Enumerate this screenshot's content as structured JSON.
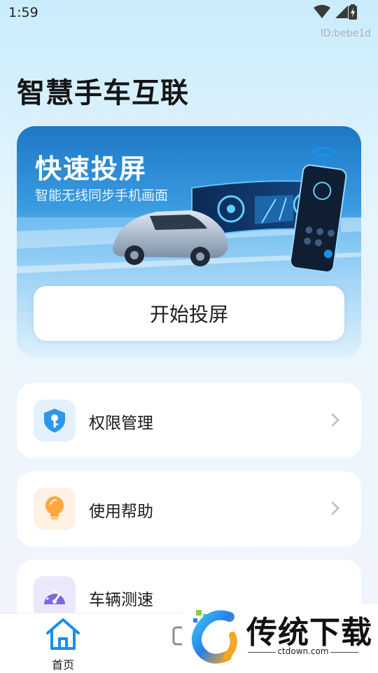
{
  "status_bar": {
    "time": "1:59"
  },
  "device_id": "ID:bebe1d",
  "app_title": "智慧手车互联",
  "hero": {
    "title": "快速投屏",
    "subtitle": "智能无线同步手机画面",
    "button_label": "开始投屏"
  },
  "menu": [
    {
      "label": "权限管理",
      "icon": "shield-key-icon",
      "icon_bg": "#e4f1fd"
    },
    {
      "label": "使用帮助",
      "icon": "lightbulb-icon",
      "icon_bg": "#fff1e3"
    },
    {
      "label": "车辆测速",
      "icon": "speedometer-icon",
      "icon_bg": "#ece8fb"
    }
  ],
  "bottom_nav": {
    "home_label": "首页"
  },
  "watermark": {
    "brand": "传统下载",
    "domain": "ctdown.com"
  },
  "colors": {
    "accent": "#1a8fe8",
    "card_bg": "#ffffff",
    "page_bg_top": "#c9ecfb"
  }
}
